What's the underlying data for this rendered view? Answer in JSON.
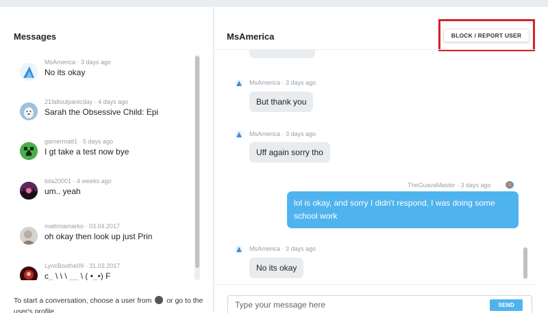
{
  "colors": {
    "accent": "#4fb3ee",
    "highlight_box": "#d62027"
  },
  "sidebar": {
    "title": "Messages",
    "conversations": [
      {
        "user": "MsAmerica",
        "time": "3 days ago",
        "preview": "No its okay",
        "avatar_icon": "cartoon-avatar-icon"
      },
      {
        "user": "21falloutpanicday",
        "time": "4 days ago",
        "preview": "Sarah the Obsessive Child: Epi",
        "avatar_icon": "dog-avatar-icon"
      },
      {
        "user": "gamermatt1",
        "time": "5 days ago",
        "preview": "I gt take a test now bye",
        "avatar_icon": "creeper-avatar-icon"
      },
      {
        "user": "lola20001",
        "time": "4 weeks ago",
        "preview": "um.. yeah",
        "avatar_icon": "landscape-avatar-icon"
      },
      {
        "user": "mattmiamarko",
        "time": "03.04.2017",
        "preview": "oh okay then look up just Prin",
        "avatar_icon": "photo-avatar-icon"
      },
      {
        "user": "LyricBoothe09",
        "time": "31.03.2017",
        "preview": "c_ \\ \\ \\ __ \\ ( •_•) F",
        "avatar_icon": "red-avatar-icon"
      }
    ],
    "footer_before": "To start a conversation, choose a user from",
    "footer_after": "or go to the user's profile."
  },
  "chat": {
    "title": "MsAmerica",
    "block_label": "BLOCK / REPORT USER",
    "messages": [
      {
        "sender": "MsAmerica",
        "time": "3 days ago",
        "text": "But thank you",
        "mine": false
      },
      {
        "sender": "MsAmerica",
        "time": "3 days ago",
        "text": "Uff again sorry tho",
        "mine": false
      },
      {
        "sender": "TheGuavaMaster",
        "time": "3 days ago",
        "text": "lol is okay, and sorry I didn't respond, I was doing some school work",
        "mine": true
      },
      {
        "sender": "MsAmerica",
        "time": "3 days ago",
        "text": "No its okay",
        "mine": false
      }
    ],
    "input_placeholder": "Type your message here",
    "send_label": "SEND"
  }
}
